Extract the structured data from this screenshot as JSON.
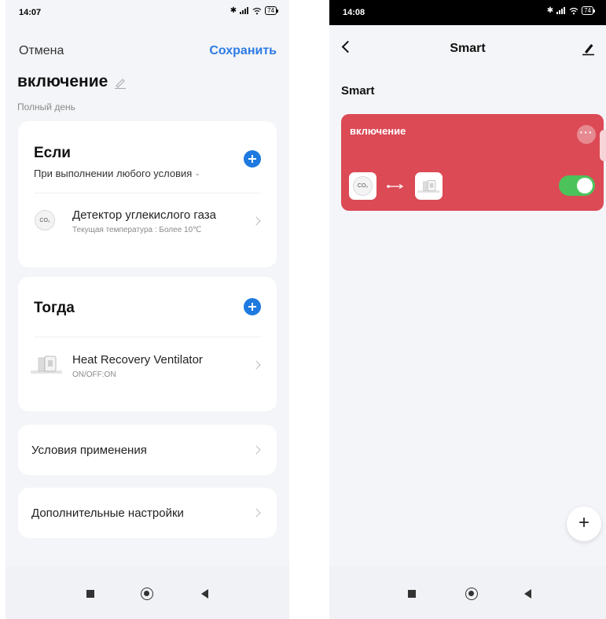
{
  "left_screen": {
    "status": {
      "time": "14:07",
      "battery": "74"
    },
    "cancel_label": "Отмена",
    "save_label": "Сохранить",
    "scene_name": "включение",
    "subtitle": "Полный день",
    "if_card": {
      "title": "Если",
      "condition_mode": "При выполнении любого условия",
      "conditions": [
        {
          "icon": "co2-sensor-icon",
          "icon_text": "CO₂",
          "title": "Детектор углекислого газа",
          "desc": "Текущая температура : Более 10℃"
        }
      ]
    },
    "then_card": {
      "title": "Тогда",
      "actions": [
        {
          "icon": "ventilator-icon",
          "title": "Heat Recovery Ventilator",
          "desc": "ON/OFF:ON"
        }
      ]
    },
    "apply_conditions_label": "Условия применения",
    "extra_settings_label": "Дополнительные настройки"
  },
  "right_screen": {
    "status": {
      "time": "14:08",
      "battery": "74"
    },
    "header_title": "Smart",
    "section_label": "Smart",
    "scenes": [
      {
        "name": "включение",
        "enabled": true,
        "color": "#db4a55",
        "co2_icon_text": "CO₂"
      }
    ],
    "fab_label": "+"
  },
  "colors": {
    "accent": "#2d7be5",
    "scene_card": "#db4a55",
    "toggle_on": "#4cc35a"
  }
}
